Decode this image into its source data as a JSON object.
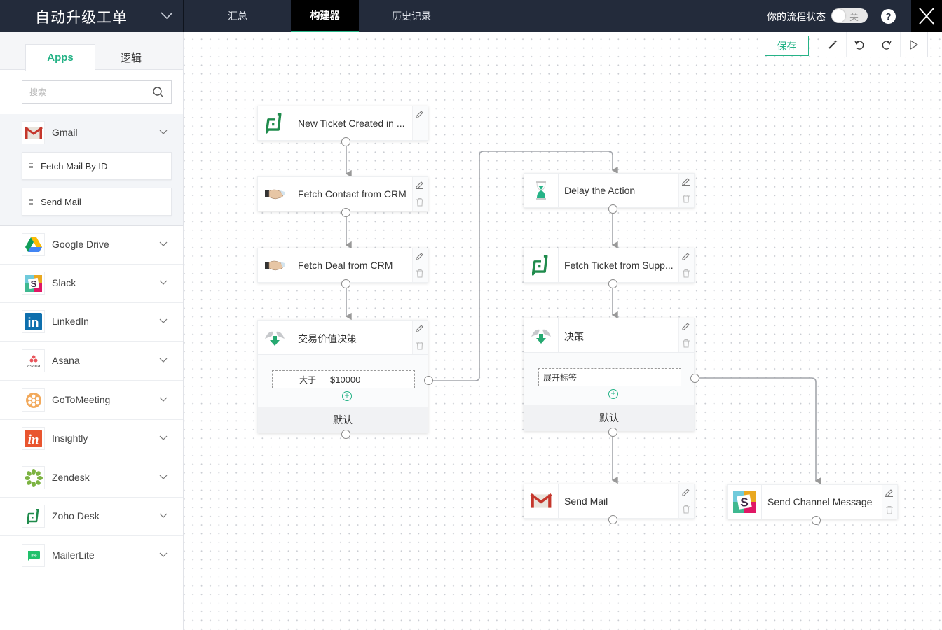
{
  "header": {
    "title": "自动升级工单",
    "tabs": [
      {
        "label": "汇总",
        "active": false
      },
      {
        "label": "构建器",
        "active": true
      },
      {
        "label": "历史记录",
        "active": false
      }
    ],
    "status_label": "你的流程状态",
    "toggle_label": "关",
    "toggle_on": false,
    "help_label": "?"
  },
  "sidebar": {
    "tabs": {
      "apps": "Apps",
      "logic": "逻辑"
    },
    "search_placeholder": "搜索",
    "expanded_app": {
      "name": "Gmail",
      "actions": [
        "Fetch Mail By ID",
        "Send Mail"
      ]
    },
    "apps": [
      "Google Drive",
      "Slack",
      "LinkedIn",
      "Asana",
      "GoToMeeting",
      "Insightly",
      "Zendesk",
      "Zoho Desk",
      "MailerLite"
    ]
  },
  "toolbar": {
    "save_label": "保存",
    "tools": [
      "magic-wand-icon",
      "undo-icon",
      "redo-icon",
      "play-icon"
    ]
  },
  "flow": {
    "nodes": {
      "trigger": "New Ticket Created in ...",
      "fetch_contact": "Fetch Contact from CRM",
      "fetch_deal": "Fetch Deal from CRM",
      "decision1": {
        "title": "交易价值决策",
        "cond_op": "大于",
        "cond_val": "$10000",
        "default": "默认"
      },
      "delay": "Delay the Action",
      "fetch_ticket": "Fetch Ticket from Supp...",
      "decision2": {
        "title": "决策",
        "cond_label": "展开标签",
        "default": "默认"
      },
      "send_mail": "Send Mail",
      "send_channel": "Send Channel Message"
    }
  },
  "colors": {
    "accent": "#26b387",
    "header_bg": "#232b3b"
  }
}
